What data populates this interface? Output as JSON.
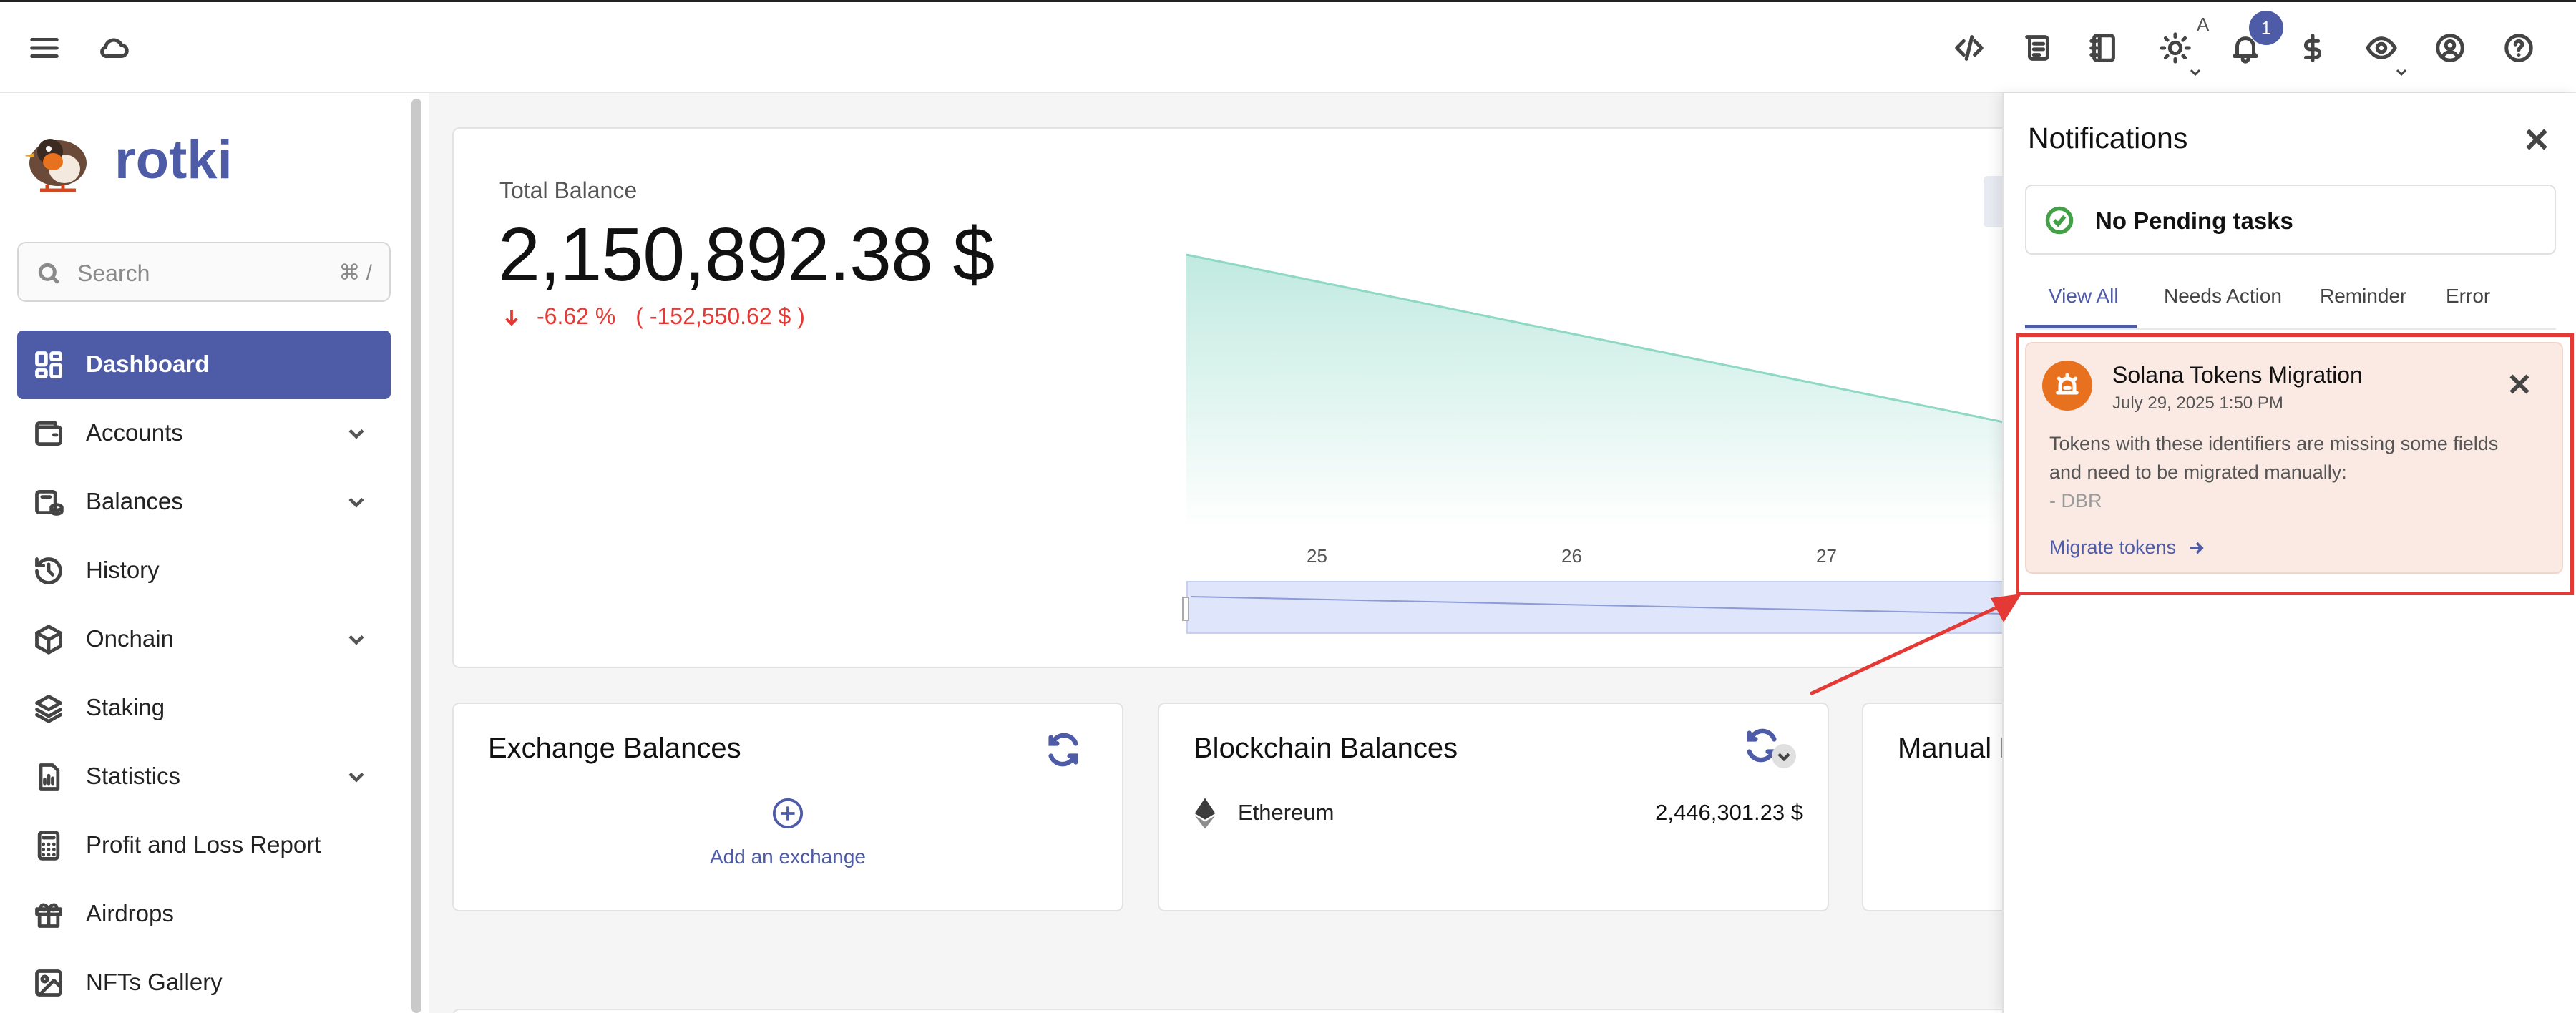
{
  "topbar": {
    "menu_icon": "hamburger-menu-icon",
    "cloud_icon": "cloud-icon",
    "notification_count": "1",
    "theme_mode": "A",
    "icons": [
      "code-icon",
      "scroll-icon",
      "notebook-icon",
      "sun-icon",
      "bell-icon",
      "dollar-icon",
      "eye-icon",
      "account-icon",
      "help-icon"
    ]
  },
  "sidebar": {
    "logo_text": "rotki",
    "search": {
      "placeholder": "Search",
      "shortcut": "⌘ /"
    },
    "items": [
      {
        "label": "Dashboard",
        "icon": "dashboard-icon",
        "active": true
      },
      {
        "label": "Accounts",
        "icon": "wallet-icon",
        "expandable": true
      },
      {
        "label": "Balances",
        "icon": "balances-icon",
        "expandable": true
      },
      {
        "label": "History",
        "icon": "history-icon"
      },
      {
        "label": "Onchain",
        "icon": "cube-icon",
        "expandable": true
      },
      {
        "label": "Staking",
        "icon": "layers-icon"
      },
      {
        "label": "Statistics",
        "icon": "statistics-icon",
        "expandable": true
      },
      {
        "label": "Profit and Loss Report",
        "icon": "calculator-icon"
      },
      {
        "label": "Airdrops",
        "icon": "gift-icon"
      },
      {
        "label": "NFTs Gallery",
        "icon": "image-icon"
      }
    ]
  },
  "total_balance": {
    "label": "Total Balance",
    "value": "2,150,892.38",
    "currency": "$",
    "change_percent": "-6.62 %",
    "change_value": "( -152,550.62 $ )"
  },
  "chart_data": {
    "type": "area",
    "x": [
      "25",
      "26",
      "27"
    ],
    "color": "#4cc3a5"
  },
  "exchange_balances": {
    "title": "Exchange Balances",
    "add_label": "Add an exchange"
  },
  "blockchain_balances": {
    "title": "Blockchain Balances",
    "rows": [
      {
        "name": "Ethereum",
        "value": "2,446,301.23 $"
      }
    ]
  },
  "manual_balances": {
    "title": "Manual B"
  },
  "notifications": {
    "title": "Notifications",
    "pending": "No Pending tasks",
    "tabs": [
      "View All",
      "Needs Action",
      "Reminder",
      "Error"
    ],
    "item": {
      "title": "Solana Tokens Migration",
      "time": "July 29, 2025 1:50 PM",
      "message_line1": "Tokens with these identifiers are missing some fields",
      "message_line2": "and need to be migrated manually:",
      "message_line3": "- DBR",
      "action": "Migrate tokens"
    }
  },
  "colors": {
    "primary": "#4e5ba6",
    "negative": "#e53935",
    "highlight": "#e53935",
    "notification_bg": "#fbeae4"
  }
}
